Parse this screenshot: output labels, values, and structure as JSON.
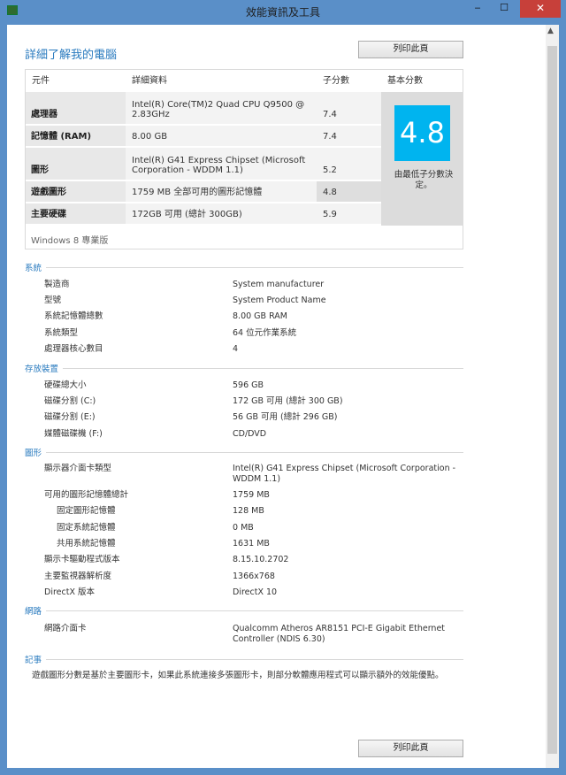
{
  "window": {
    "title": "效能資訊及工具",
    "minimize": "‒",
    "maximize": "☐",
    "close": "✕"
  },
  "heading": "詳細了解我的電腦",
  "print_label": "列印此頁",
  "table": {
    "headers": [
      "元件",
      "詳細資料",
      "子分數",
      "基本分數"
    ],
    "rows": [
      {
        "component": "處理器",
        "details": "Intel(R) Core(TM)2 Quad CPU Q9500 @ 2.83GHz",
        "subscore": "7.4"
      },
      {
        "component": "記憶體 (RAM)",
        "details": "8.00 GB",
        "subscore": "7.4"
      },
      {
        "component": "圖形",
        "details": "Intel(R) G41 Express Chipset (Microsoft Corporation - WDDM 1.1)",
        "subscore": "5.2"
      },
      {
        "component": "遊戲圖形",
        "details": "1759 MB 全部可用的圖形記憶體",
        "subscore": "4.8"
      },
      {
        "component": "主要硬碟",
        "details": "172GB 可用 (總計 300GB)",
        "subscore": "5.9"
      }
    ],
    "base_score": "4.8",
    "base_note": "由最低子分數決定。",
    "edition": "Windows 8 專業版"
  },
  "sections": [
    {
      "title": "系統",
      "items": [
        {
          "label": "製造商",
          "value": "System manufacturer"
        },
        {
          "label": "型號",
          "value": "System Product Name"
        },
        {
          "label": "系統記憶體總數",
          "value": "8.00 GB RAM"
        },
        {
          "label": "系統類型",
          "value": "64 位元作業系統"
        },
        {
          "label": "處理器核心數目",
          "value": "4"
        }
      ]
    },
    {
      "title": "存放裝置",
      "items": [
        {
          "label": "硬碟總大小",
          "value": "596 GB"
        },
        {
          "label": "磁碟分割 (C:)",
          "value": "172 GB 可用 (總計 300 GB)"
        },
        {
          "label": "磁碟分割 (E:)",
          "value": "56 GB 可用 (總計 296 GB)"
        },
        {
          "label": "媒體磁碟機 (F:)",
          "value": "CD/DVD"
        }
      ]
    },
    {
      "title": "圖形",
      "items": [
        {
          "label": "顯示器介面卡類型",
          "value": "Intel(R) G41 Express Chipset (Microsoft Corporation - WDDM 1.1)"
        },
        {
          "label": "可用的圖形記憶體總計",
          "value": "1759 MB"
        },
        {
          "label": "固定圖形記憶體",
          "value": "128 MB",
          "indent": true
        },
        {
          "label": "固定系統記憶體",
          "value": "0 MB",
          "indent": true
        },
        {
          "label": "共用系統記憶體",
          "value": "1631 MB",
          "indent": true
        },
        {
          "label": "顯示卡驅動程式版本",
          "value": "8.15.10.2702"
        },
        {
          "label": "主要監視器解析度",
          "value": "1366x768"
        },
        {
          "label": "DirectX 版本",
          "value": "DirectX 10"
        }
      ]
    },
    {
      "title": "網路",
      "items": [
        {
          "label": "網路介面卡",
          "value": "Qualcomm Atheros AR8151 PCI-E Gigabit Ethernet Controller (NDIS 6.30)"
        }
      ]
    },
    {
      "title": "記事",
      "items": []
    }
  ],
  "note": "遊戲圖形分數是基於主要圖形卡，如果此系統連接多張圖形卡，則部分軟體應用程式可以顯示額外的效能優點。"
}
